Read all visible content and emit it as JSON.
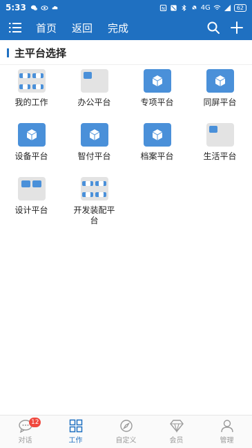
{
  "status_bar": {
    "time": "5:33",
    "network": "4G",
    "battery": "62"
  },
  "header": {
    "links": [
      "首页",
      "返回",
      "完成"
    ],
    "icons": [
      "menu-icon",
      "search-icon",
      "plus-icon"
    ]
  },
  "section": {
    "title": "主平台选择"
  },
  "tiles": [
    {
      "label": "我的工作",
      "icon": "quad"
    },
    {
      "label": "办公平台",
      "icon": "gray"
    },
    {
      "label": "专项平台",
      "icon": "solid"
    },
    {
      "label": "同屏平台",
      "icon": "solid"
    },
    {
      "label": "设备平台",
      "icon": "solid"
    },
    {
      "label": "智付平台",
      "icon": "solid"
    },
    {
      "label": "档案平台",
      "icon": "solid"
    },
    {
      "label": "生活平台",
      "icon": "gray"
    },
    {
      "label": "设计平台",
      "icon": "pair"
    },
    {
      "label": "开发装配平台",
      "icon": "quad"
    }
  ],
  "bottom_nav": {
    "items": [
      {
        "label": "对话",
        "icon": "chat-icon",
        "badge": "12"
      },
      {
        "label": "工作",
        "icon": "grid-icon",
        "active": true
      },
      {
        "label": "自定义",
        "icon": "compass-icon"
      },
      {
        "label": "会员",
        "icon": "diamond-icon"
      },
      {
        "label": "管理",
        "icon": "person-icon"
      }
    ]
  },
  "colors": {
    "primary": "#1f70c1",
    "tile_blue": "#4a90d9",
    "tile_gray": "#e3e3e3",
    "badge": "#f0483e"
  }
}
